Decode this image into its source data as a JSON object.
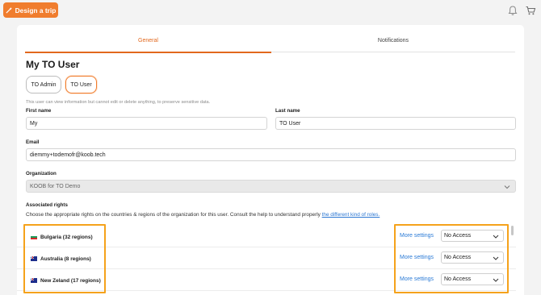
{
  "header": {
    "design_trip_label": "Design a trip",
    "icons": [
      "wand-icon",
      "bell-icon",
      "cart-icon"
    ]
  },
  "tabs": [
    {
      "label": "General",
      "active": true
    },
    {
      "label": "Notifications",
      "active": false
    }
  ],
  "page_title": "My TO User",
  "roles": [
    {
      "label": "TO Admin",
      "selected": false
    },
    {
      "label": "TO User",
      "selected": true
    }
  ],
  "role_hint": "This user can view information but cannot edit or delete anything, to preserve sensitive data.",
  "form": {
    "first_name": {
      "label": "First name",
      "value": "My"
    },
    "last_name": {
      "label": "Last name",
      "value": "TO User"
    },
    "email": {
      "label": "Email",
      "value": "diemmy+todemofr@koob.tech"
    },
    "organization": {
      "label": "Organization",
      "value": "KOOB for TO Demo"
    }
  },
  "rights": {
    "label": "Associated rights",
    "description": "Choose the appropriate rights on the countries & regions of the organization for this user. Consult the help to understand properly ",
    "help_link": "the different kind of roles.",
    "rows": [
      {
        "region": "Bulgaria (32 regions)",
        "flag": "bulgaria-flag",
        "more": "More settings",
        "access": "No Access"
      },
      {
        "region": "Australia (8 regions)",
        "flag": "australia-flag",
        "more": "More settings",
        "access": "No Access"
      },
      {
        "region": "New Zeland (17 regions)",
        "flag": "new-zealand-flag",
        "more": "More settings",
        "access": "No Access"
      }
    ]
  },
  "colors": {
    "accent": "#f07d2e",
    "link": "#2a7ad6",
    "highlight": "#f5a21b"
  }
}
